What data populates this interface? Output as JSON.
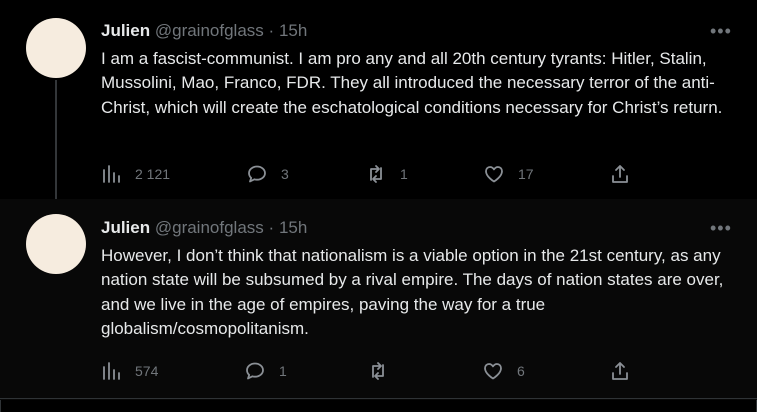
{
  "tweets": [
    {
      "name": "Julien",
      "handle": "@grainofglass",
      "separator": "·",
      "time": "15h",
      "text": "I am a fascist-communist. I am pro any and all 20th century tyrants: Hitler, Stalin, Mussolini, Mao, Franco, FDR. They all introduced the necessary terror of the anti-Christ, which will create the eschatological conditions necessary for Christ’s return.",
      "views": "2 121",
      "replies": "3",
      "retweets": "1",
      "likes": "17"
    },
    {
      "name": "Julien",
      "handle": "@grainofglass",
      "separator": "·",
      "time": "15h",
      "text": "However, I don’t think that nationalism is a viable option in the 21st century, as any nation state will be subsumed by a rival empire. The days of nation states are over, and we live in the age of empires, paving the way for a true globalism/cosmopolitanism.",
      "views": "574",
      "replies": "1",
      "retweets": "",
      "likes": "6"
    }
  ],
  "icons": {
    "more": "more-icon",
    "views": "views-icon",
    "reply": "reply-icon",
    "retweet": "retweet-icon",
    "like": "like-icon",
    "share": "share-icon"
  },
  "colors": {
    "background": "#000000",
    "text": "#e7e9ea",
    "secondary": "#71767b",
    "avatar": "#f6ecdf"
  }
}
